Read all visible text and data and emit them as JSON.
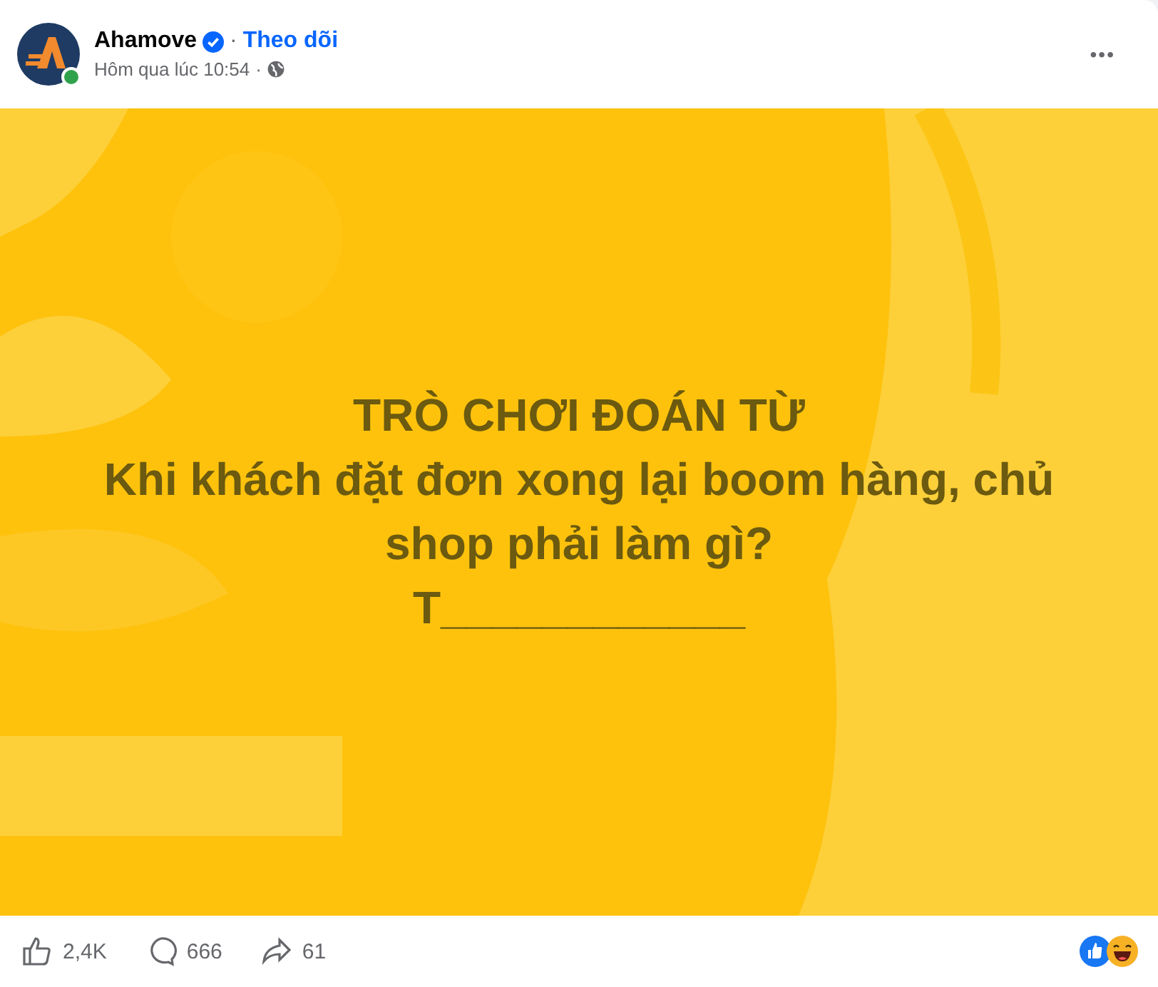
{
  "post": {
    "author": "Ahamove",
    "verified": true,
    "separator": "·",
    "follow": "Theo dõi",
    "time": "Hôm qua lúc 10:54",
    "time_separator": "·",
    "online": true,
    "more": "•••"
  },
  "image": {
    "lines": [
      "TRÒ CHƠI ĐOÁN TỪ",
      "Khi khách đặt đơn xong lại boom hàng, chủ shop phải làm gì?",
      "T____________"
    ]
  },
  "stats": {
    "likes": "2,4K",
    "comments": "666",
    "shares": "61"
  }
}
